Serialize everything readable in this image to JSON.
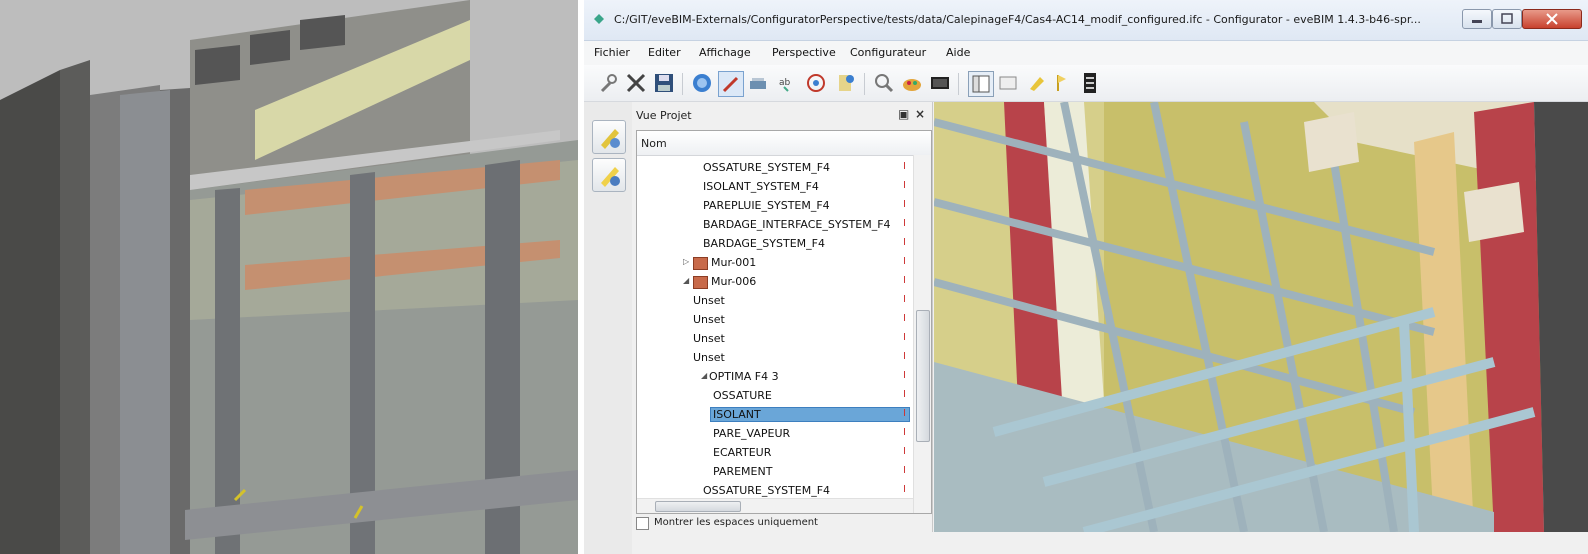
{
  "window": {
    "title": "C:/GIT/eveBIM-Externals/ConfiguratorPerspective/tests/data/CalepinageF4/Cas4-AC14_modif_configured.ifc - Configurator - eveBIM 1.4.3-b46-spr..."
  },
  "menu": [
    "Fichier",
    "Editer",
    "Affichage",
    "Perspective",
    "Configurateur",
    "Aide"
  ],
  "toolbar_icons": [
    "wrench-icon",
    "scissors-icon",
    "save-icon",
    "globe-icon",
    "pencil-icon",
    "object-icon",
    "properties-icon",
    "target-icon",
    "config-icon",
    "search-icon",
    "cake-icon",
    "screen-icon",
    "layout-icon",
    "window-icon",
    "marker-icon",
    "flag-icon",
    "stack-icon"
  ],
  "project_panel": {
    "title": "Vue Projet",
    "column": "Nom",
    "rows": [
      {
        "label": "OSSATURE_SYSTEM_F4",
        "level": 3,
        "mark": "I"
      },
      {
        "label": "ISOLANT_SYSTEM_F4",
        "level": 3,
        "mark": "I"
      },
      {
        "label": "PAREPLUIE_SYSTEM_F4",
        "level": 3,
        "mark": "I"
      },
      {
        "label": "BARDAGE_INTERFACE_SYSTEM_F4",
        "level": 3,
        "mark": "I"
      },
      {
        "label": "BARDAGE_SYSTEM_F4",
        "level": 3,
        "mark": "I"
      },
      {
        "label": "Mur-001",
        "level": 2,
        "mark": "I"
      },
      {
        "label": "Mur-006",
        "level": 2,
        "mark": "I"
      },
      {
        "label": "Unset",
        "level": 2,
        "mark": "I"
      },
      {
        "label": "Unset",
        "level": 2,
        "mark": "I"
      },
      {
        "label": "Unset",
        "level": 2,
        "mark": "I"
      },
      {
        "label": "Unset",
        "level": 2,
        "mark": "I"
      },
      {
        "label": "OPTIMA F4 3",
        "level": 2,
        "mark": "I"
      },
      {
        "label": "OSSATURE",
        "level": 4,
        "mark": "I"
      },
      {
        "label": "ISOLANT",
        "level": 4,
        "mark": "I"
      },
      {
        "label": "PARE_VAPEUR",
        "level": 4,
        "mark": "I"
      },
      {
        "label": "ECARTEUR",
        "level": 4,
        "mark": "I"
      },
      {
        "label": "PAREMENT",
        "level": 4,
        "mark": "I"
      },
      {
        "label": "OSSATURE_SYSTEM_F4",
        "level": 3,
        "mark": "I"
      }
    ],
    "selected_index": 13,
    "checkbox_label": "Montrer les espaces uniquement",
    "checkbox_checked": false
  },
  "colors": {
    "selection": "#6aa6d8",
    "insulation": "#c8bf6a",
    "frame": "#9aa6b2",
    "rainscreen": "#b8434a"
  }
}
